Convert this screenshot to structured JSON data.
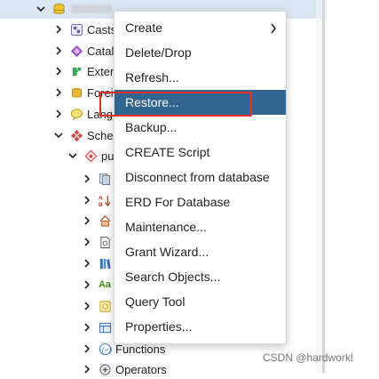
{
  "tree": {
    "rows": [
      {
        "label": "Casts",
        "icon": "casts-icon",
        "indent": 1
      },
      {
        "label": "Catal",
        "icon": "catalogs-icon",
        "indent": 1
      },
      {
        "label": "Exter",
        "icon": "extensions-icon",
        "indent": 1
      },
      {
        "label": "Forei",
        "icon": "foreign-data-wrappers-icon",
        "indent": 1
      },
      {
        "label": "Lang",
        "icon": "languages-icon",
        "indent": 1
      },
      {
        "label": "Sche",
        "icon": "schemas-icon",
        "indent": 1,
        "expanded": true
      },
      {
        "label": "pu",
        "icon": "public-schema-icon",
        "indent": 2,
        "expanded": true
      }
    ],
    "functions_label": "Functions",
    "operators_label": "Operators",
    "small_label_aa": "Aa"
  },
  "context_menu": {
    "items": [
      {
        "label": "Create",
        "has_submenu": true
      },
      {
        "label": "Delete/Drop"
      },
      {
        "label": "Refresh..."
      },
      {
        "label": "Restore...",
        "active": true
      },
      {
        "label": "Backup..."
      },
      {
        "label": "CREATE Script"
      },
      {
        "label": "Disconnect from database"
      },
      {
        "label": "ERD For Database"
      },
      {
        "label": "Maintenance..."
      },
      {
        "label": "Grant Wizard..."
      },
      {
        "label": "Search Objects..."
      },
      {
        "label": "Query Tool"
      },
      {
        "label": "Properties..."
      }
    ]
  },
  "watermark": "CSDN @hardworkl",
  "colors": {
    "menu_active": "#326690",
    "highlight_box": "#e0302c",
    "row_selected": "#dbe6f3"
  }
}
